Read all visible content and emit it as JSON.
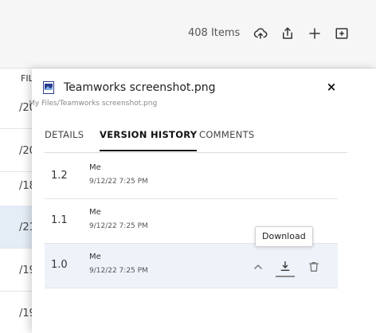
{
  "toolbar": {
    "item_count": "408 Items",
    "icons": [
      "cloud-upload-icon",
      "share-icon",
      "plus-icon",
      "new-folder-icon"
    ]
  },
  "background_list": {
    "header": "FIL",
    "rows": [
      "/20",
      "/20",
      "/18",
      "/21",
      "/19",
      "/19"
    ]
  },
  "panel": {
    "file_name": "Teamworks screenshot.png",
    "file_path": "My Files/Teamworks screenshot.png",
    "close_label": "×",
    "tabs": [
      {
        "label": "DETAILS",
        "active": false
      },
      {
        "label": "VERSION HISTORY",
        "active": true
      },
      {
        "label": "COMMENTS",
        "active": false
      }
    ],
    "versions": [
      {
        "number": "1.2",
        "author": "Me",
        "date": "9/12/22 7:25 PM"
      },
      {
        "number": "1.1",
        "author": "Me",
        "date": "9/12/22 7:25 PM"
      },
      {
        "number": "1.0",
        "author": "Me",
        "date": "9/12/22 7:25 PM"
      }
    ],
    "tooltip": "Download"
  }
}
